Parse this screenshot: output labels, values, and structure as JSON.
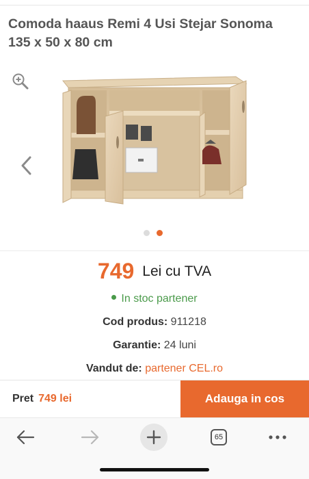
{
  "product": {
    "title": "Comoda haaus Remi 4 Usi Stejar Sonoma 135 x 50 x 80 cm"
  },
  "gallery": {
    "zoom_icon": "zoom-in-icon",
    "prev_icon": "chevron-left-icon",
    "image_count": 2,
    "active_image": 2
  },
  "price": {
    "value": "749",
    "currency": "Lei cu TVA"
  },
  "stock": {
    "text": "In stoc partener"
  },
  "details": {
    "code_label": "Cod produs:",
    "code_value": "911218",
    "warranty_label": "Garantie:",
    "warranty_value": "24 luni",
    "seller_label": "Vandut de:",
    "seller_value": "partener CEL.ro"
  },
  "bottom_bar": {
    "price_label": "Pret",
    "price_value": "749 lei",
    "add_button": "Adauga in cos"
  },
  "browser": {
    "tab_count": "65"
  },
  "colors": {
    "accent": "#e8692e",
    "stock_green": "#4a9a4a"
  }
}
